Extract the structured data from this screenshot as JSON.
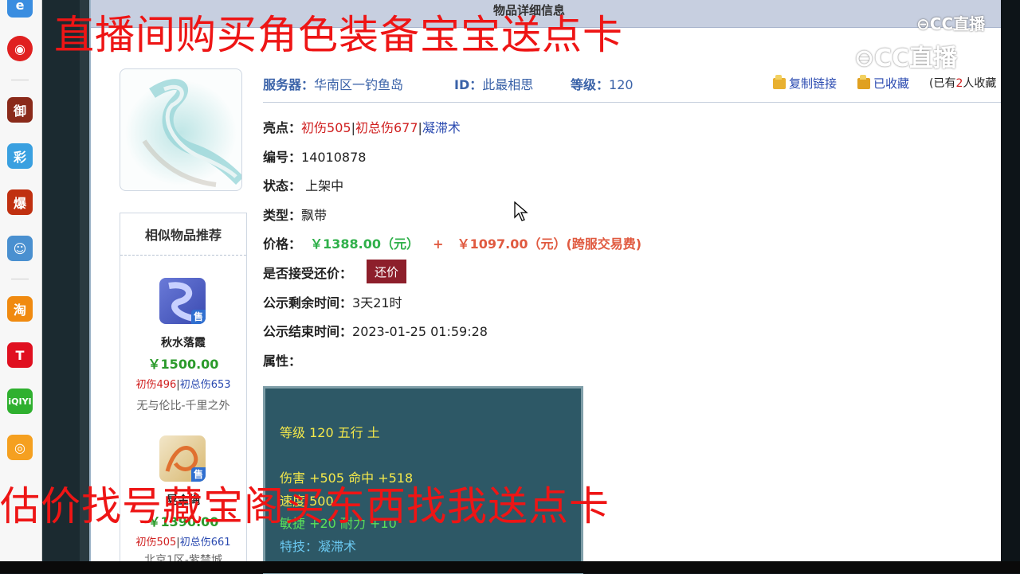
{
  "overlay": {
    "top_text": "直播间购买角色装备宝宝送点卡",
    "bottom_text": "估价找号藏宝阁买东西找我送点卡"
  },
  "watermarks": {
    "logo_small": "CC直播",
    "logo_large": "CC直播"
  },
  "page": {
    "header_title": "物品详细信息"
  },
  "header_info": {
    "server_label": "服务器：",
    "server_value": "华南区一钓鱼岛",
    "id_label": "ID：",
    "id_value": "此最相思",
    "level_label": "等级：",
    "level_value": "120",
    "copy_link": "复制链接",
    "favorited": "已收藏",
    "fav_count_prefix": "(已有",
    "fav_count": "2",
    "fav_count_suffix": "人收藏"
  },
  "details": {
    "highlight_label": "亮点：",
    "highlight_1": "初伤505",
    "highlight_2": "初总伤677",
    "highlight_3": "凝滞术",
    "number_label": "编号：",
    "number_value": "14010878",
    "status_label": "状态：",
    "status_value": "上架中",
    "type_label": "类型：",
    "type_value": "飘带",
    "price_label": "价格：",
    "price_main": "￥1388.00（元）",
    "price_plus": "+",
    "price_fee": "￥1097.00（元）(跨服交易费)",
    "bargain_label": "是否接受还价：",
    "bargain_button": "还价",
    "remain_label": "公示剩余时间：",
    "remain_value": "3天21时",
    "end_label": "公示结束时间：",
    "end_value": "2023-01-25 01:59:28",
    "attr_label": "属性："
  },
  "attributes": {
    "line1": "等级 120 五行 土",
    "line2": "伤害 +505 命中 +518",
    "line3": "速度 500",
    "line4": "敏捷 +20 耐力 +10",
    "line5": "特技：凝滞术"
  },
  "similar": {
    "title": "相似物品推荐",
    "items": [
      {
        "name": "秋水落霞",
        "price": "￥1500.00",
        "tag1": "初伤496",
        "tag2": "初总伤653",
        "server": "无与伦比-千里之外",
        "sale": "售"
      },
      {
        "name": "晃金绳",
        "price": "￥1390.00",
        "tag1": "初伤505",
        "tag2": "初总伤661",
        "server": "北京1区-紫禁城",
        "sale": "售"
      }
    ]
  },
  "sidebar_apps": [
    "360浏览器",
    "网易云音乐",
    "游戏",
    "彩",
    "爆",
    "游戏2",
    "淘",
    "T",
    "iQIYI",
    "微博"
  ],
  "colors": {
    "accent_red": "#ee1515",
    "price_green": "#2fb04a",
    "bargain_button": "#8d1f2b",
    "attr_panel": "#2d5866"
  }
}
